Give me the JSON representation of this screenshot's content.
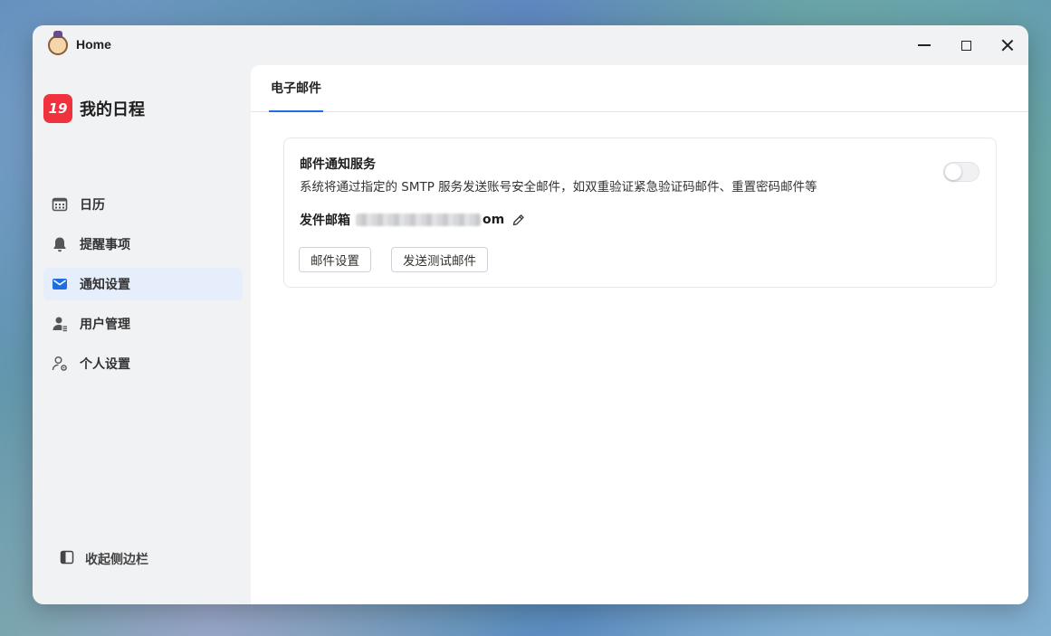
{
  "window": {
    "title": "Home"
  },
  "brand": {
    "badge": "19",
    "name": "我的日程",
    "color": "#f0323f"
  },
  "sidebar": {
    "items": [
      {
        "label": "日历",
        "icon": "calendar-icon",
        "active": false
      },
      {
        "label": "提醒事项",
        "icon": "bell-icon",
        "active": false
      },
      {
        "label": "通知设置",
        "icon": "mail-icon",
        "active": true
      },
      {
        "label": "用户管理",
        "icon": "user-manage-icon",
        "active": false
      },
      {
        "label": "个人设置",
        "icon": "user-settings-icon",
        "active": false
      }
    ],
    "collapse_label": "收起侧边栏"
  },
  "main": {
    "tabs": [
      {
        "label": "电子邮件",
        "active": true
      }
    ],
    "card": {
      "title": "邮件通知服务",
      "description": "系统将通过指定的 SMTP 服务发送账号安全邮件，如双重验证紧急验证码邮件、重置密码邮件等",
      "toggle_on": false,
      "sender_label": "发件邮箱",
      "sender_value_visible_suffix": "om",
      "buttons": {
        "settings": "邮件设置",
        "test": "发送测试邮件"
      }
    }
  },
  "colors": {
    "accent": "#1e6fe0",
    "active_bg": "#e6eefb"
  }
}
